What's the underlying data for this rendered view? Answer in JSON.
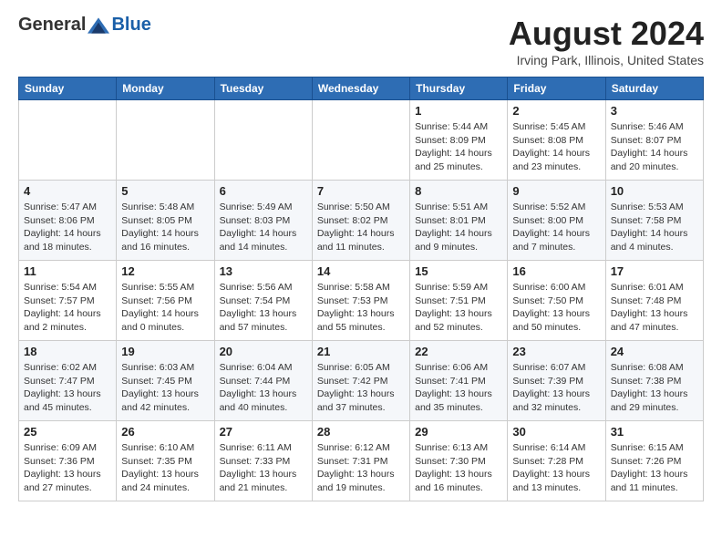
{
  "header": {
    "logo": {
      "general": "General",
      "blue": "Blue"
    },
    "month_title": "August 2024",
    "location": "Irving Park, Illinois, United States"
  },
  "calendar": {
    "days_of_week": [
      "Sunday",
      "Monday",
      "Tuesday",
      "Wednesday",
      "Thursday",
      "Friday",
      "Saturday"
    ],
    "weeks": [
      [
        {
          "day": "",
          "info": ""
        },
        {
          "day": "",
          "info": ""
        },
        {
          "day": "",
          "info": ""
        },
        {
          "day": "",
          "info": ""
        },
        {
          "day": "1",
          "info": "Sunrise: 5:44 AM\nSunset: 8:09 PM\nDaylight: 14 hours\nand 25 minutes."
        },
        {
          "day": "2",
          "info": "Sunrise: 5:45 AM\nSunset: 8:08 PM\nDaylight: 14 hours\nand 23 minutes."
        },
        {
          "day": "3",
          "info": "Sunrise: 5:46 AM\nSunset: 8:07 PM\nDaylight: 14 hours\nand 20 minutes."
        }
      ],
      [
        {
          "day": "4",
          "info": "Sunrise: 5:47 AM\nSunset: 8:06 PM\nDaylight: 14 hours\nand 18 minutes."
        },
        {
          "day": "5",
          "info": "Sunrise: 5:48 AM\nSunset: 8:05 PM\nDaylight: 14 hours\nand 16 minutes."
        },
        {
          "day": "6",
          "info": "Sunrise: 5:49 AM\nSunset: 8:03 PM\nDaylight: 14 hours\nand 14 minutes."
        },
        {
          "day": "7",
          "info": "Sunrise: 5:50 AM\nSunset: 8:02 PM\nDaylight: 14 hours\nand 11 minutes."
        },
        {
          "day": "8",
          "info": "Sunrise: 5:51 AM\nSunset: 8:01 PM\nDaylight: 14 hours\nand 9 minutes."
        },
        {
          "day": "9",
          "info": "Sunrise: 5:52 AM\nSunset: 8:00 PM\nDaylight: 14 hours\nand 7 minutes."
        },
        {
          "day": "10",
          "info": "Sunrise: 5:53 AM\nSunset: 7:58 PM\nDaylight: 14 hours\nand 4 minutes."
        }
      ],
      [
        {
          "day": "11",
          "info": "Sunrise: 5:54 AM\nSunset: 7:57 PM\nDaylight: 14 hours\nand 2 minutes."
        },
        {
          "day": "12",
          "info": "Sunrise: 5:55 AM\nSunset: 7:56 PM\nDaylight: 14 hours\nand 0 minutes."
        },
        {
          "day": "13",
          "info": "Sunrise: 5:56 AM\nSunset: 7:54 PM\nDaylight: 13 hours\nand 57 minutes."
        },
        {
          "day": "14",
          "info": "Sunrise: 5:58 AM\nSunset: 7:53 PM\nDaylight: 13 hours\nand 55 minutes."
        },
        {
          "day": "15",
          "info": "Sunrise: 5:59 AM\nSunset: 7:51 PM\nDaylight: 13 hours\nand 52 minutes."
        },
        {
          "day": "16",
          "info": "Sunrise: 6:00 AM\nSunset: 7:50 PM\nDaylight: 13 hours\nand 50 minutes."
        },
        {
          "day": "17",
          "info": "Sunrise: 6:01 AM\nSunset: 7:48 PM\nDaylight: 13 hours\nand 47 minutes."
        }
      ],
      [
        {
          "day": "18",
          "info": "Sunrise: 6:02 AM\nSunset: 7:47 PM\nDaylight: 13 hours\nand 45 minutes."
        },
        {
          "day": "19",
          "info": "Sunrise: 6:03 AM\nSunset: 7:45 PM\nDaylight: 13 hours\nand 42 minutes."
        },
        {
          "day": "20",
          "info": "Sunrise: 6:04 AM\nSunset: 7:44 PM\nDaylight: 13 hours\nand 40 minutes."
        },
        {
          "day": "21",
          "info": "Sunrise: 6:05 AM\nSunset: 7:42 PM\nDaylight: 13 hours\nand 37 minutes."
        },
        {
          "day": "22",
          "info": "Sunrise: 6:06 AM\nSunset: 7:41 PM\nDaylight: 13 hours\nand 35 minutes."
        },
        {
          "day": "23",
          "info": "Sunrise: 6:07 AM\nSunset: 7:39 PM\nDaylight: 13 hours\nand 32 minutes."
        },
        {
          "day": "24",
          "info": "Sunrise: 6:08 AM\nSunset: 7:38 PM\nDaylight: 13 hours\nand 29 minutes."
        }
      ],
      [
        {
          "day": "25",
          "info": "Sunrise: 6:09 AM\nSunset: 7:36 PM\nDaylight: 13 hours\nand 27 minutes."
        },
        {
          "day": "26",
          "info": "Sunrise: 6:10 AM\nSunset: 7:35 PM\nDaylight: 13 hours\nand 24 minutes."
        },
        {
          "day": "27",
          "info": "Sunrise: 6:11 AM\nSunset: 7:33 PM\nDaylight: 13 hours\nand 21 minutes."
        },
        {
          "day": "28",
          "info": "Sunrise: 6:12 AM\nSunset: 7:31 PM\nDaylight: 13 hours\nand 19 minutes."
        },
        {
          "day": "29",
          "info": "Sunrise: 6:13 AM\nSunset: 7:30 PM\nDaylight: 13 hours\nand 16 minutes."
        },
        {
          "day": "30",
          "info": "Sunrise: 6:14 AM\nSunset: 7:28 PM\nDaylight: 13 hours\nand 13 minutes."
        },
        {
          "day": "31",
          "info": "Sunrise: 6:15 AM\nSunset: 7:26 PM\nDaylight: 13 hours\nand 11 minutes."
        }
      ]
    ]
  }
}
